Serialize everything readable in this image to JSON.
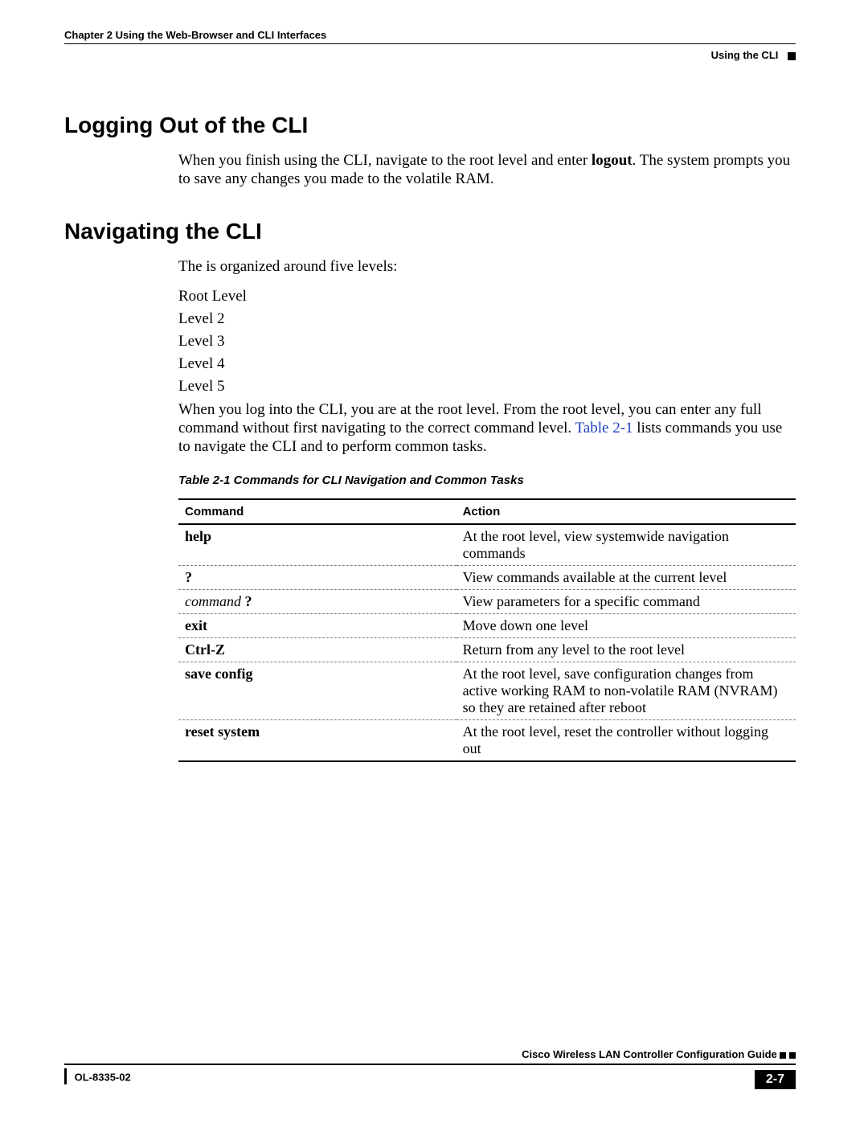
{
  "header": {
    "chapter": "Chapter 2      Using the Web-Browser and CLI Interfaces",
    "section": "Using the CLI"
  },
  "sections": {
    "heading1": "Logging Out of the CLI",
    "para1_a": "When you finish using the CLI, navigate to the root level and enter ",
    "para1_b": "logout",
    "para1_c": ". The system prompts you to save any changes you made to the volatile RAM.",
    "heading2": "Navigating the CLI",
    "para2": "The is organized around five levels:",
    "levels": [
      "Root Level",
      "Level 2",
      "Level 3",
      "Level 4",
      "Level 5"
    ],
    "para3_a": "When you log into the CLI, you are at the root level. From the root level, you can enter any full command without first navigating to the correct command level. ",
    "para3_link": "Table 2-1",
    "para3_b": " lists commands you use to navigate the CLI and to perform common tasks."
  },
  "table": {
    "caption": "Table 2-1     Commands for CLI Navigation and Common Tasks",
    "headers": {
      "c1": "Command",
      "c2": "Action"
    },
    "rows": [
      {
        "cmd": "help",
        "style": "bold",
        "action": "At the root level, view systemwide navigation commands",
        "sep": true
      },
      {
        "cmd": "?",
        "style": "bold",
        "action": "View commands available at the current level",
        "sep": true
      },
      {
        "cmd": "command",
        "suffix": " ?",
        "style": "italic",
        "suffixStyle": "bold",
        "action": "View parameters for a specific command",
        "sep": true
      },
      {
        "cmd": "exit",
        "style": "bold",
        "action": "Move down one level",
        "sep": true
      },
      {
        "cmd": "Ctrl-Z",
        "style": "bold",
        "action": "Return from any level to the root level",
        "sep": true
      },
      {
        "cmd": "save config",
        "style": "bold",
        "action": "At the root level, save configuration changes from active working RAM to non-volatile RAM (NVRAM) so they are retained after reboot",
        "sep": true
      },
      {
        "cmd": "reset system",
        "style": "bold",
        "action": "At the root level, reset the controller without logging out",
        "sep": false
      }
    ]
  },
  "footer": {
    "guide": "Cisco Wireless LAN Controller Configuration Guide",
    "doc": "OL-8335-02",
    "page": "2-7"
  }
}
